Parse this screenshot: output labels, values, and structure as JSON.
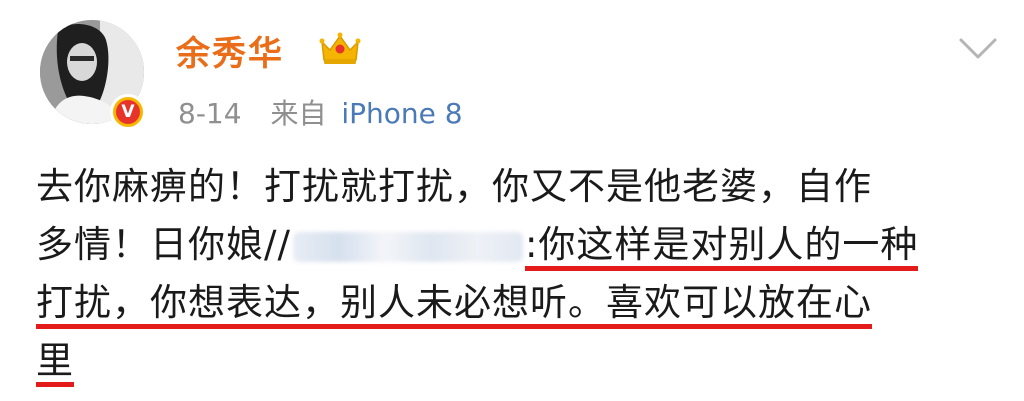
{
  "post": {
    "author": "余秀华",
    "date": "8-14",
    "source_prefix": "来自",
    "source": "iPhone 8",
    "content": {
      "line1": "去你麻痹的！打扰就打扰，你又不是他老婆，自作",
      "line2_before": "多情！日你娘//",
      "line2_after": ":你这样是对别人的一种",
      "line3": "打扰，你想表达，别人未必想听。喜欢可以放在心",
      "line4": "里"
    }
  },
  "colors": {
    "name": "#ea6e1a",
    "source_link": "#4a7ab7",
    "underline": "#e31b1b",
    "verified_outer": "#f5b700",
    "verified_inner": "#e8332a"
  },
  "icons": {
    "verified": "verified-badge-icon",
    "member": "crown-icon",
    "menu": "chevron-down-icon"
  }
}
